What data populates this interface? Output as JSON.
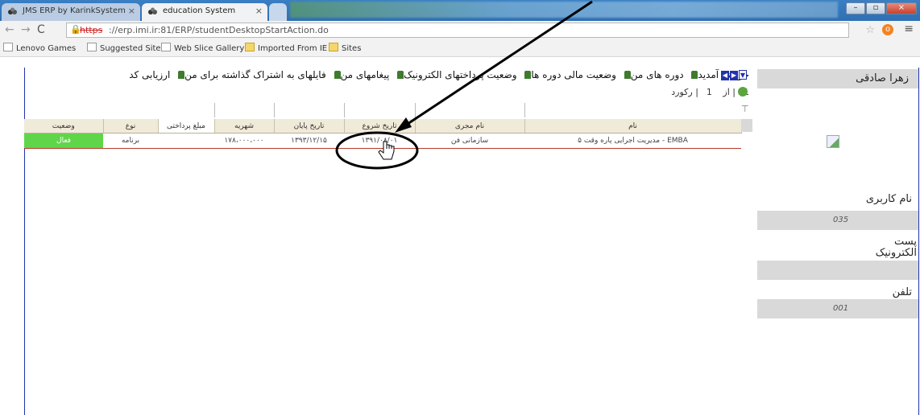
{
  "browser": {
    "tabs": [
      {
        "title": "JMS ERP by KarinkSystem",
        "active": false
      },
      {
        "title": "education System",
        "active": true
      }
    ],
    "url_scheme": "https",
    "url_rest": "://erp.imi.ir:81/ERP/studentDesktopStartAction.do",
    "bookmarks": [
      "Lenovo Games",
      "Suggested Sites",
      "Web Slice Gallery",
      "Imported From IE",
      "Sites"
    ]
  },
  "menu": {
    "items": [
      "حوزش آمدید",
      "دوره های من",
      "وضعیت مالی دوره ها",
      "وضعیت پرداختهای الکترونیک",
      "پیغامهای من",
      "فایلهای به اشتراک گذاشته برای من",
      "ارزیابی کد"
    ]
  },
  "pager": {
    "page": "1",
    "of": "از",
    "total": "1",
    "records": "رکورد"
  },
  "grid": {
    "columns": [
      "وضعیت",
      "نوع",
      "مبلغ پرداختی",
      "شهریه",
      "تاریخ پایان",
      "تاریخ شروع",
      "نام مجری",
      "نام"
    ],
    "rows": [
      [
        "فعال",
        "برنامه",
        "",
        "۱۷۸،۰۰۰،۰۰۰",
        "۱۳۹۳/۱۲/۱۵",
        "۱۳۹۱/۰۸/۰۱",
        "سازمانی فن",
        "مدیریت اجرایی پاره وقت ۵ - EMBA"
      ]
    ]
  },
  "sidebar": {
    "user_name": "زهرا صادقی",
    "username_label": "نام کاربری",
    "username_value": "035",
    "email_label": "پست الکترونیک",
    "email_value": "",
    "phone_label": "تلفن",
    "phone_value": "001"
  },
  "colors": {
    "status_active": "#5fd64a",
    "frame": "#2233aa",
    "menu_icon": "#3e7b2e"
  }
}
